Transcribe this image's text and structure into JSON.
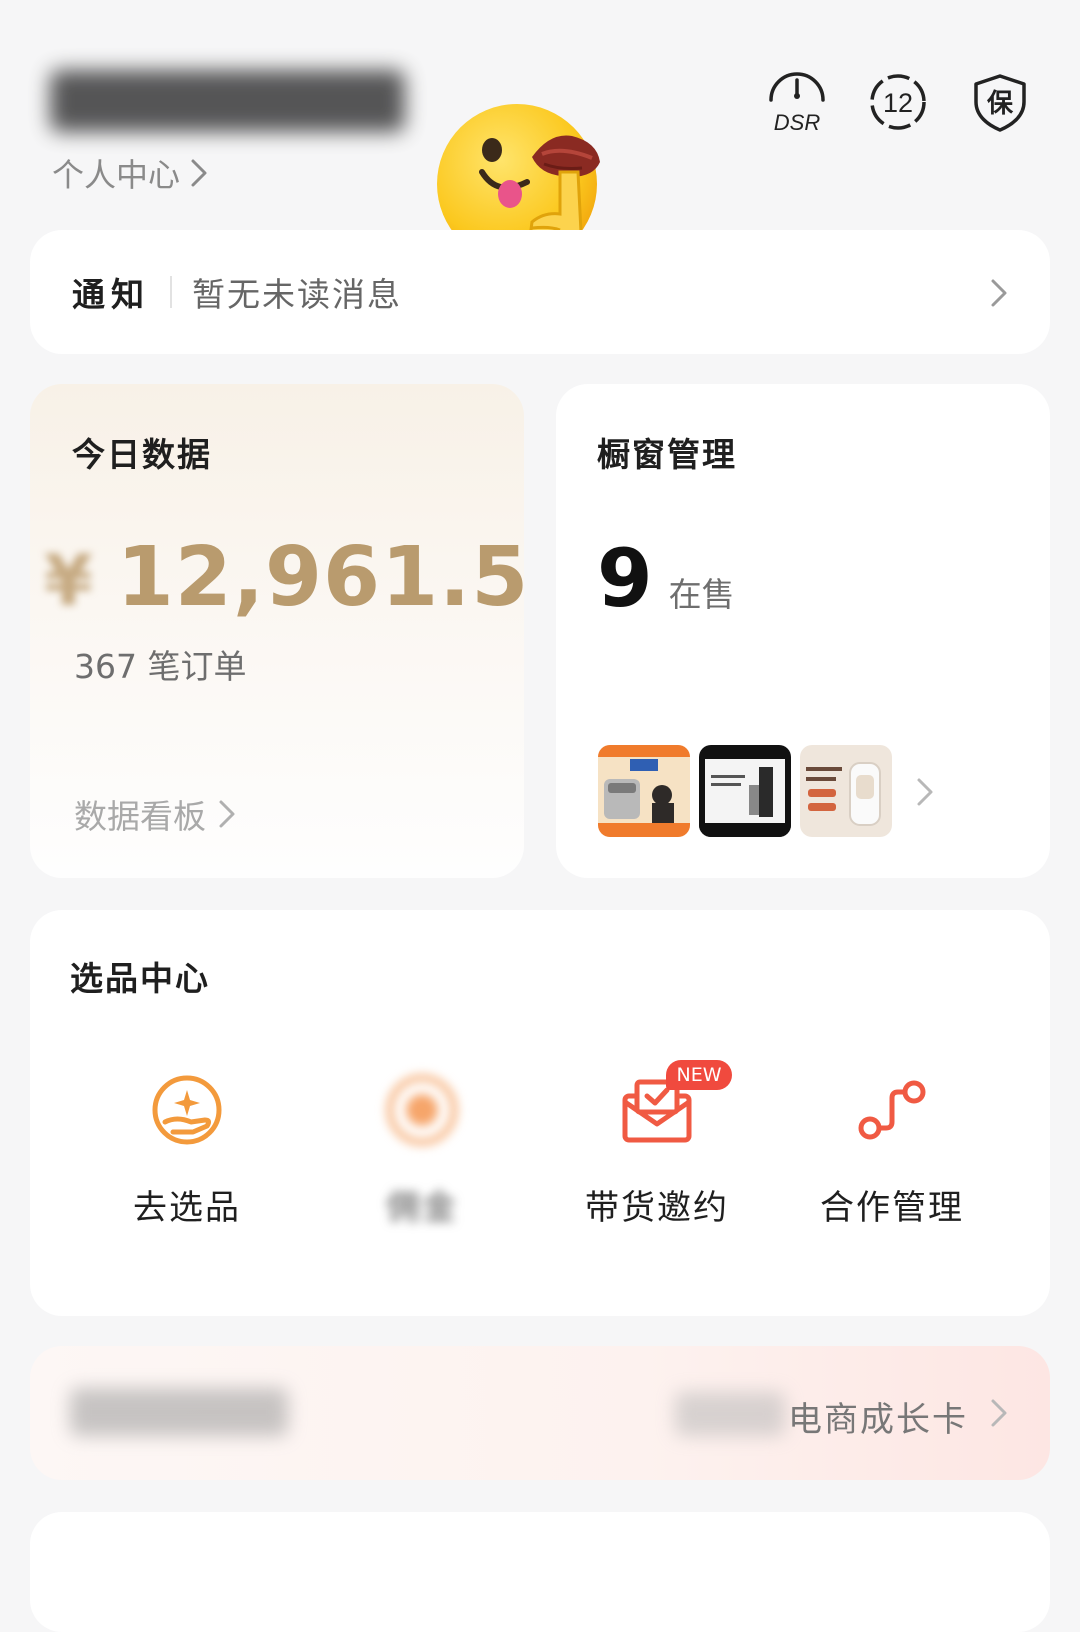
{
  "header": {
    "username_hidden": true,
    "personal_center": "个人中心",
    "icons": [
      {
        "name": "dsr-icon",
        "label": "DSR"
      },
      {
        "name": "level-badge-icon",
        "label": "12"
      },
      {
        "name": "shield-icon",
        "label": "保"
      }
    ]
  },
  "notice": {
    "title": "通知",
    "message": "暂无未读消息"
  },
  "today": {
    "title": "今日数据",
    "currency": "¥",
    "amount": "12,961.5",
    "orders": "367 笔订单",
    "link": "数据看板"
  },
  "window": {
    "title": "橱窗管理",
    "count": "9",
    "count_label": "在售",
    "thumbnails": [
      "rice-cooker-product",
      "appliance-product",
      "blender-product"
    ]
  },
  "select_center": {
    "title": "选品中心",
    "tools": [
      {
        "label": "去选品",
        "icon": "sparkle-hand-icon"
      },
      {
        "label": "佣金",
        "icon": "yen-coin-icon",
        "blurred": true
      },
      {
        "label": "带货邀约",
        "icon": "invite-envelope-icon",
        "badge": "NEW"
      },
      {
        "label": "合作管理",
        "icon": "path-node-icon"
      }
    ]
  },
  "growth": {
    "label": "电商成长卡"
  },
  "colors": {
    "accent": "#f39a3c",
    "gold": "#b99b6e",
    "red": "#f04a3e"
  }
}
